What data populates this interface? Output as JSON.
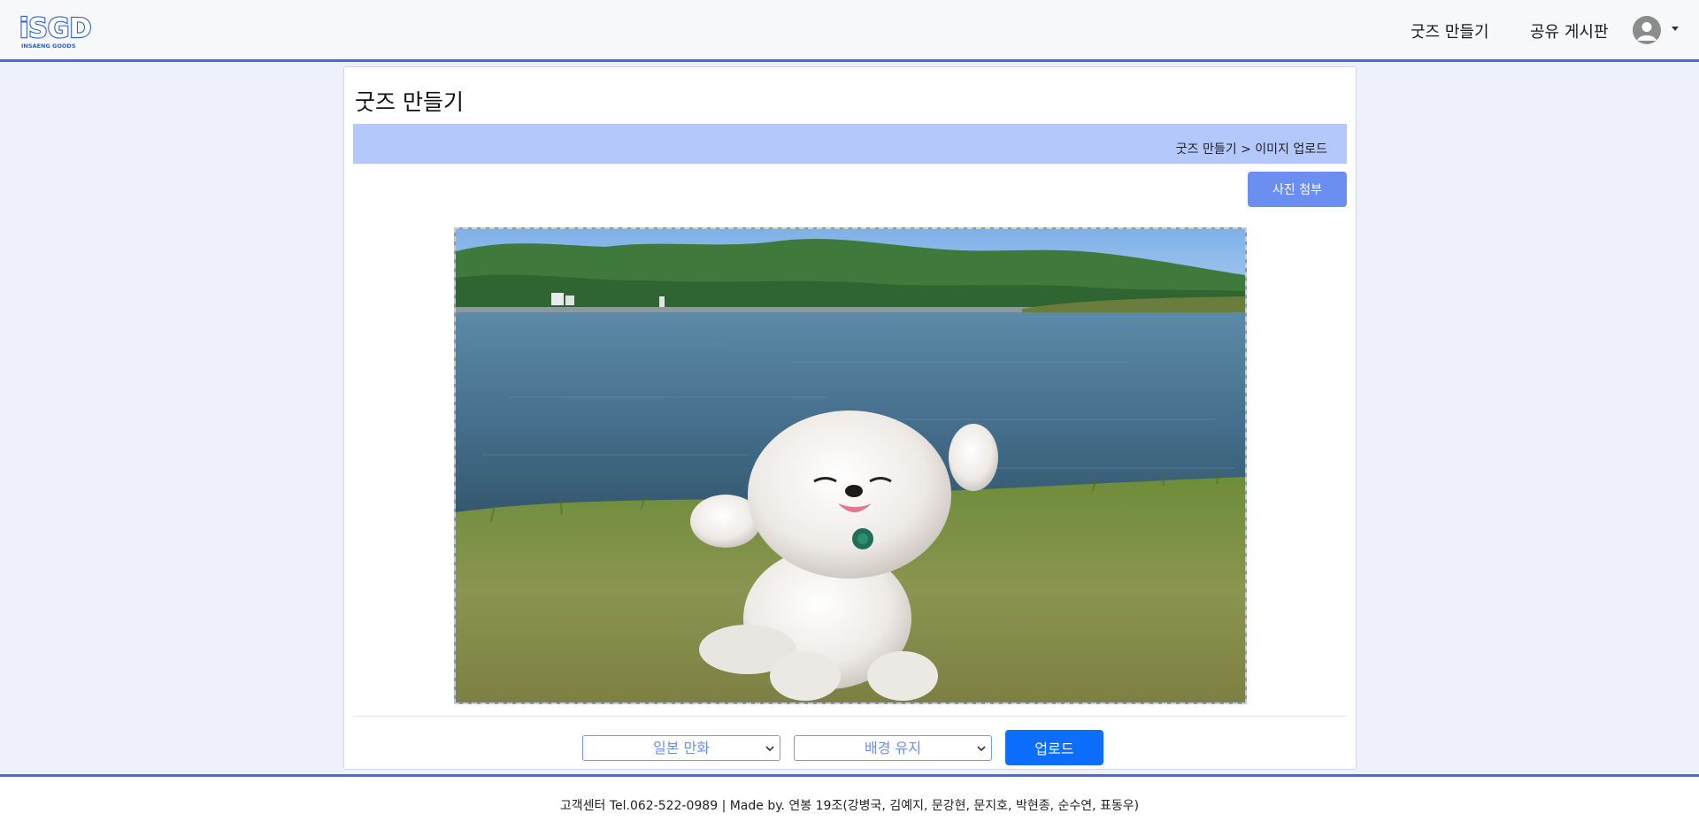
{
  "header": {
    "logo_text": "iSGD",
    "logo_subtext": "INSAENG GOODS",
    "nav": {
      "make_goods": "굿즈 만들기",
      "share_board": "공유 게시판"
    },
    "icons": {
      "avatar": "user-avatar-icon",
      "menu": "caret-down-icon"
    }
  },
  "main": {
    "title": "굿즈 만들기",
    "breadcrumb": "굿즈 만들기 > 이미지 업로드",
    "attach_button": "사진 첨부",
    "preview_image": "photo-preview",
    "style_select": {
      "selected": "일본 만화"
    },
    "background_select": {
      "selected": "배경 유지"
    },
    "upload_button": "업로드"
  },
  "footer": {
    "text": "고객센터 Tel.062-522-0989 | Made by. 연봉 19조(강병국, 김예지, 문강현, 문지호, 박현종, 순수연, 표동우)"
  },
  "colors": {
    "header_border": "#3d6fe0",
    "breadcrumb_bg": "#b4c8fc",
    "attach_button": "#6b8ff0",
    "upload_button": "#0d6efd",
    "page_bg": "#eef1fb"
  }
}
